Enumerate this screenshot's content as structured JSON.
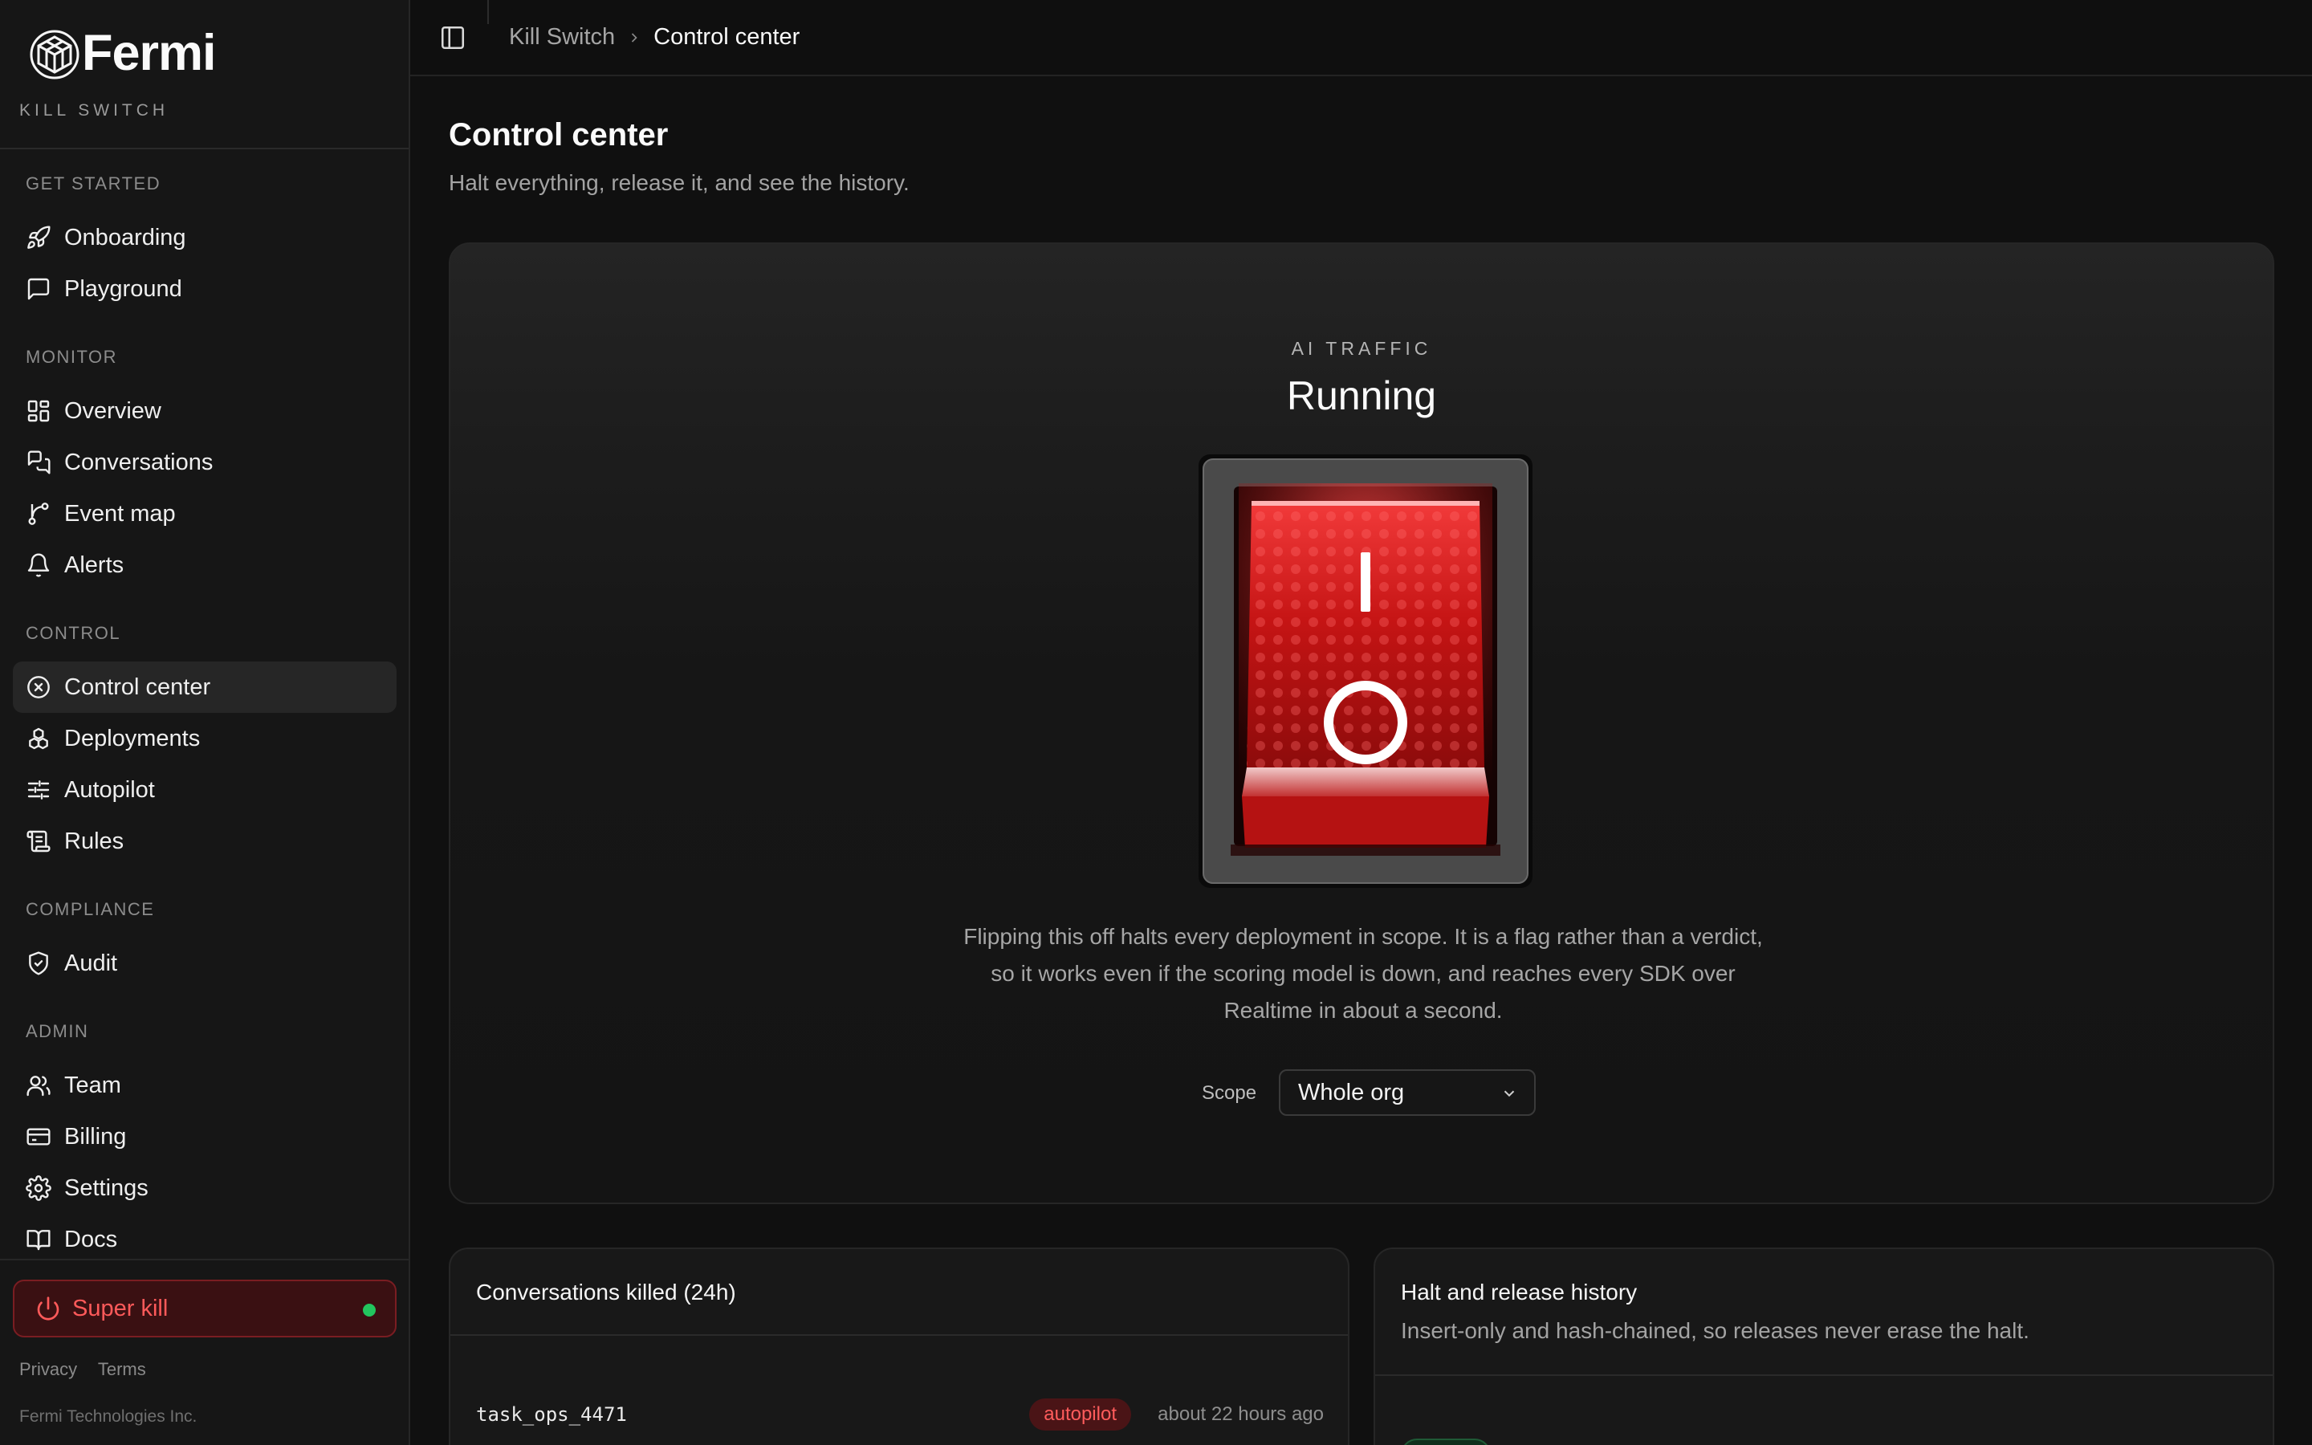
{
  "brand": {
    "name": "Fermi",
    "product": "KILL SWITCH"
  },
  "sidebar": {
    "groups": [
      {
        "title": "GET STARTED",
        "items": [
          {
            "label": "Onboarding",
            "icon": "rocket-icon"
          },
          {
            "label": "Playground",
            "icon": "chat-square-icon"
          }
        ]
      },
      {
        "title": "MONITOR",
        "items": [
          {
            "label": "Overview",
            "icon": "dashboard-icon"
          },
          {
            "label": "Conversations",
            "icon": "chats-icon"
          },
          {
            "label": "Event map",
            "icon": "branch-icon"
          },
          {
            "label": "Alerts",
            "icon": "bell-icon"
          }
        ]
      },
      {
        "title": "CONTROL",
        "items": [
          {
            "label": "Control center",
            "icon": "circle-x-icon",
            "active": true
          },
          {
            "label": "Deployments",
            "icon": "boxes-icon"
          },
          {
            "label": "Autopilot",
            "icon": "sliders-icon"
          },
          {
            "label": "Rules",
            "icon": "scroll-icon"
          }
        ]
      },
      {
        "title": "COMPLIANCE",
        "items": [
          {
            "label": "Audit",
            "icon": "shield-check-icon"
          }
        ]
      },
      {
        "title": "ADMIN",
        "items": [
          {
            "label": "Team",
            "icon": "users-icon"
          },
          {
            "label": "Billing",
            "icon": "credit-card-icon"
          },
          {
            "label": "Settings",
            "icon": "gear-icon"
          },
          {
            "label": "Docs",
            "icon": "book-icon"
          }
        ]
      }
    ],
    "super_kill": {
      "label": "Super kill",
      "status_color": "#22c55e"
    },
    "footer": {
      "privacy": "Privacy",
      "terms": "Terms",
      "copyright": "Fermi Technologies Inc."
    }
  },
  "topbar": {
    "breadcrumb": [
      "Kill Switch",
      "Control center"
    ]
  },
  "page": {
    "title": "Control center",
    "subtitle": "Halt everything, release it, and see the history."
  },
  "hero": {
    "kicker": "AI TRAFFIC",
    "state": "Running",
    "switch": {
      "on_symbol": "I",
      "off_symbol": "O",
      "accent": "#e01b1b"
    },
    "description": "Flipping this off halts every deployment in scope. It is a flag rather than a verdict, so it works even if the scoring model is down, and reaches every SDK over Realtime in about a second.",
    "scope": {
      "label": "Scope",
      "value": "Whole org"
    }
  },
  "killed_card": {
    "title": "Conversations killed (24h)",
    "rows": [
      {
        "id": "task_ops_4471",
        "badge": "autopilot",
        "time": "about 22 hours ago"
      }
    ]
  },
  "history_card": {
    "title": "Halt and release history",
    "subtitle": "Insert-only and hash-chained, so releases never erase the halt."
  }
}
